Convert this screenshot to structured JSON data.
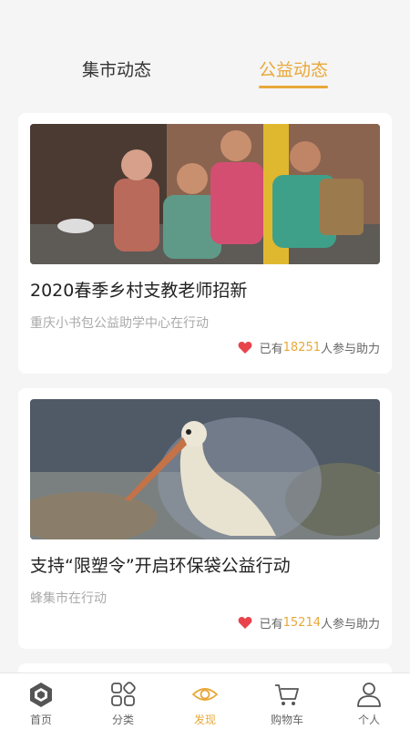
{
  "tabs": [
    {
      "label": "集市动态",
      "active": false
    },
    {
      "label": "公益动态",
      "active": true
    }
  ],
  "cards": [
    {
      "title": "2020春季乡村支教老师招新",
      "org": "重庆小书包公益助学中心在行动",
      "support_prefix": "已有",
      "support_count": "18251",
      "support_suffix": "人参与助力"
    },
    {
      "title": "支持“限塑令”开启环保袋公益行动",
      "org": "蜂集市在行动",
      "support_prefix": "已有",
      "support_count": "15214",
      "support_suffix": "人参与助力"
    }
  ],
  "bottom_nav": [
    {
      "label": "首页",
      "icon": "home-hex-icon"
    },
    {
      "label": "分类",
      "icon": "category-grid-icon"
    },
    {
      "label": "发现",
      "icon": "eye-icon",
      "active": true
    },
    {
      "label": "购物车",
      "icon": "cart-icon"
    },
    {
      "label": "个人",
      "icon": "person-icon"
    }
  ],
  "colors": {
    "accent": "#e8a83a",
    "heart": "#e8434b"
  }
}
